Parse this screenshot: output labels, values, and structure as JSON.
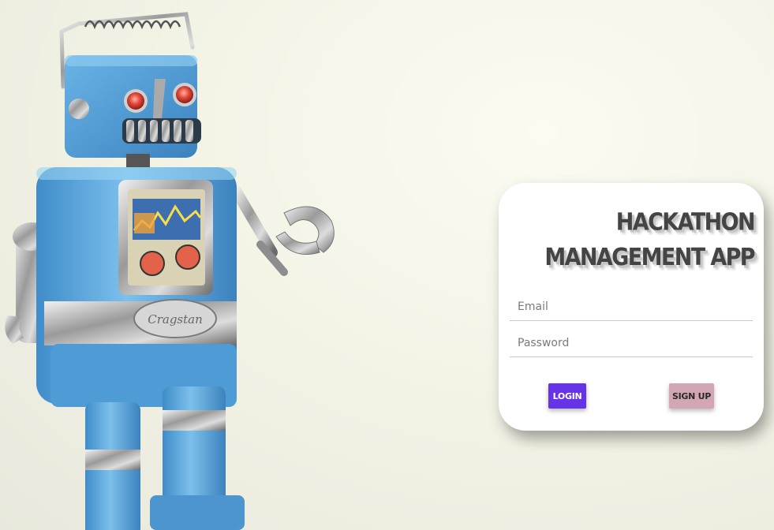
{
  "background": {
    "illustration": "vintage-tin-robot",
    "robot_plate_text": "Cragstan"
  },
  "login_card": {
    "title": "HACKATHON MANAGEMENT APP",
    "email_placeholder": "Email",
    "password_placeholder": "Password",
    "login_label": "LOGIN",
    "signup_label": "SIGN UP"
  },
  "colors": {
    "login_button": "#6633e6",
    "signup_button": "#d2a6b3",
    "title_text": "#444444",
    "robot_blue": "#5fa9dd"
  }
}
